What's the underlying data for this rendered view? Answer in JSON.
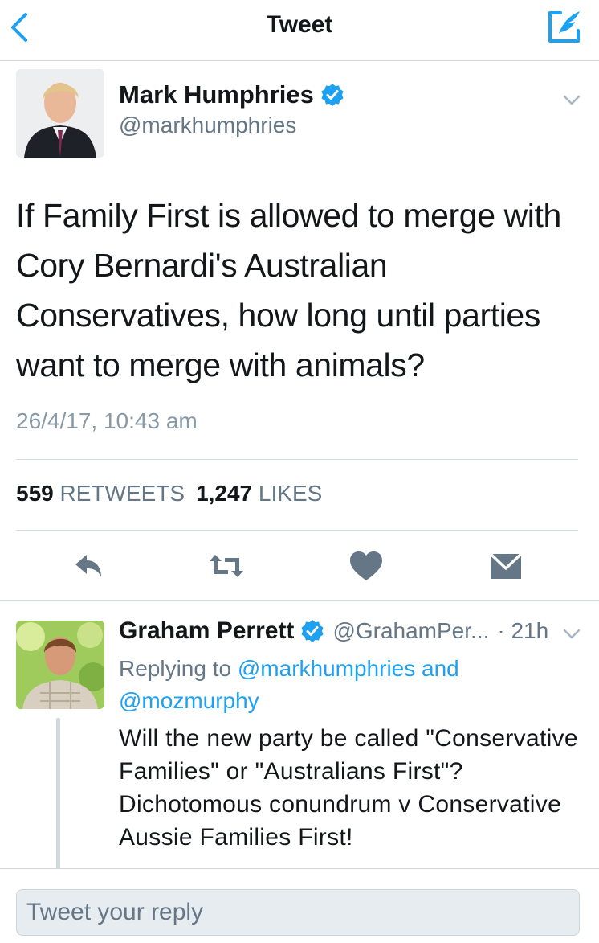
{
  "nav": {
    "title": "Tweet"
  },
  "tweet": {
    "author_name": "Mark Humphries",
    "author_handle": "@markhumphries",
    "text": "If Family First is allowed to merge with Cory Bernardi's Australian Conservatives, how long until parties want to merge with animals?",
    "timestamp": "26/4/17, 10:43 am",
    "retweets_count": "559",
    "retweets_label": "RETWEETS",
    "likes_count": "1,247",
    "likes_label": "LIKES"
  },
  "reply": {
    "author_name": "Graham Perrett",
    "author_handle": "@GrahamPer...",
    "time": "· 21h",
    "replying_prefix": "Replying to",
    "replying_to_1": "@markhumphries",
    "replying_and": "and",
    "replying_to_2": "@mozmurphy",
    "text": "Will the new party be called \"Conservative Families\" or \"Australians First\"?  Dichotomous conundrum v Conservative Aussie Families First!"
  },
  "composer": {
    "placeholder": "Tweet your reply"
  },
  "icons": {
    "back": "back-chevron-icon",
    "compose": "compose-tweet-icon",
    "verified": "verified-badge-icon",
    "caret": "chevron-down-icon",
    "reply": "reply-icon",
    "retweet": "retweet-icon",
    "like": "heart-icon",
    "dm": "envelope-icon"
  },
  "colors": {
    "accent": "#1da1f2",
    "text_primary": "#14171a",
    "text_secondary": "#657786",
    "action_icon": "#657786"
  }
}
